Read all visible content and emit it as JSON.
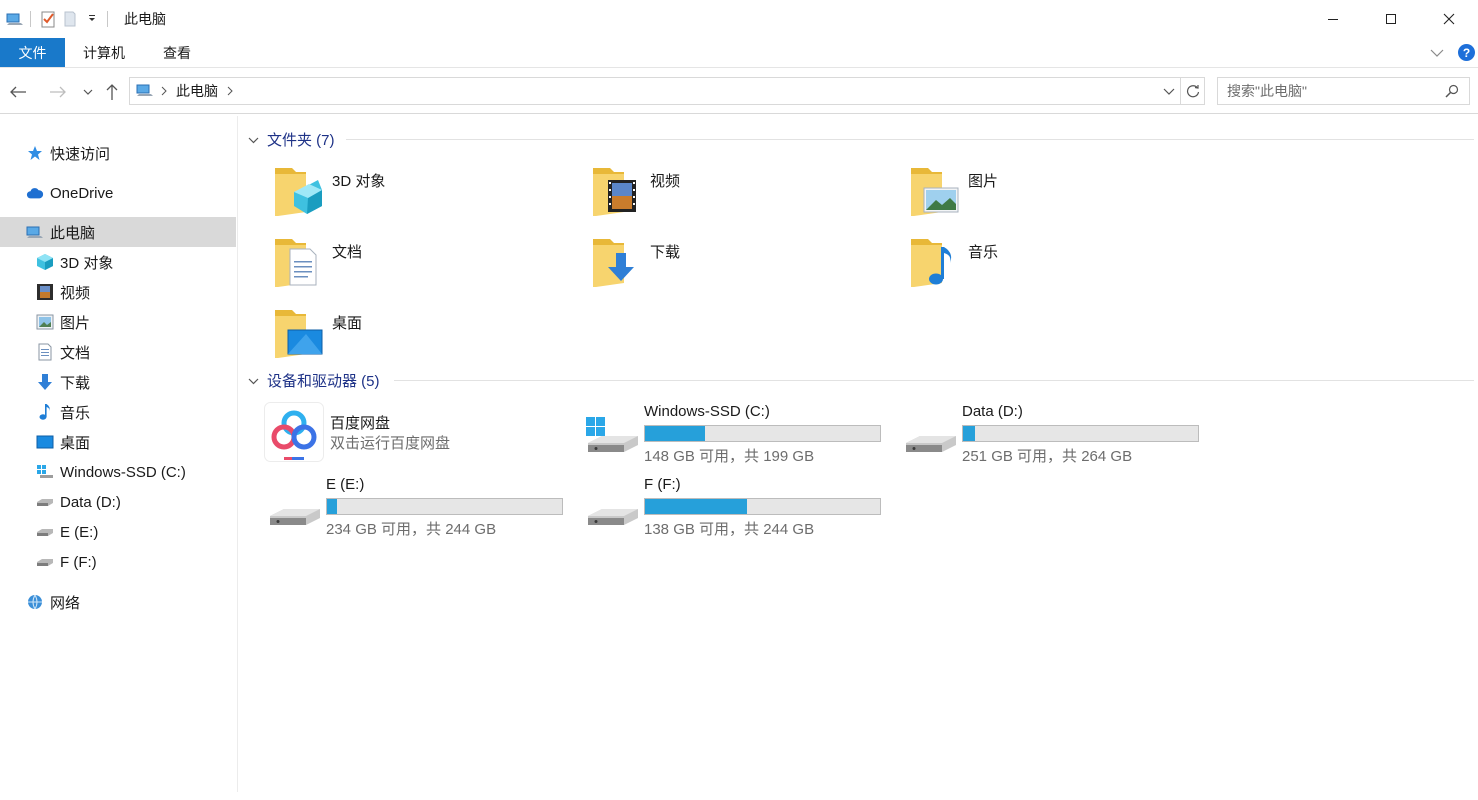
{
  "window": {
    "title": "此电脑"
  },
  "ribbon": {
    "tabs": [
      "文件",
      "计算机",
      "查看"
    ]
  },
  "address": {
    "crumbs": [
      "此电脑"
    ]
  },
  "search": {
    "placeholder": "搜索\"此电脑\""
  },
  "sidebar": {
    "items": [
      {
        "label": "快速访问",
        "icon": "star-icon"
      },
      {
        "label": "OneDrive",
        "icon": "cloud-icon"
      },
      {
        "label": "此电脑",
        "icon": "computer-icon",
        "selected": true
      },
      {
        "label": "3D 对象",
        "icon": "cube-icon"
      },
      {
        "label": "视频",
        "icon": "film-icon"
      },
      {
        "label": "图片",
        "icon": "picture-icon"
      },
      {
        "label": "文档",
        "icon": "document-icon"
      },
      {
        "label": "下载",
        "icon": "download-icon"
      },
      {
        "label": "音乐",
        "icon": "music-icon"
      },
      {
        "label": "桌面",
        "icon": "desktop-icon"
      },
      {
        "label": "Windows-SSD (C:)",
        "icon": "windows-drive-icon"
      },
      {
        "label": "Data (D:)",
        "icon": "drive-icon"
      },
      {
        "label": "E (E:)",
        "icon": "drive-icon"
      },
      {
        "label": "F (F:)",
        "icon": "drive-icon"
      },
      {
        "label": "网络",
        "icon": "network-icon"
      }
    ]
  },
  "folders": {
    "header": "文件夹 (7)",
    "items": [
      {
        "label": "3D 对象",
        "icon": "cube-folder-icon"
      },
      {
        "label": "视频",
        "icon": "video-folder-icon"
      },
      {
        "label": "图片",
        "icon": "pictures-folder-icon"
      },
      {
        "label": "文档",
        "icon": "documents-folder-icon"
      },
      {
        "label": "下载",
        "icon": "downloads-folder-icon"
      },
      {
        "label": "音乐",
        "icon": "music-folder-icon"
      },
      {
        "label": "桌面",
        "icon": "desktop-folder-icon"
      }
    ]
  },
  "devices": {
    "header": "设备和驱动器 (5)",
    "baidu": {
      "label": "百度网盘",
      "sub": "双击运行百度网盘"
    },
    "drives": [
      {
        "label": "Windows-SSD (C:)",
        "sub": "148 GB 可用，共 199 GB",
        "used_fraction": 0.256
      },
      {
        "label": "Data (D:)",
        "sub": "251 GB 可用，共 264 GB",
        "used_fraction": 0.049
      },
      {
        "label": "E (E:)",
        "sub": "234 GB 可用，共 244 GB",
        "used_fraction": 0.041
      },
      {
        "label": "F (F:)",
        "sub": "138 GB 可用，共 244 GB",
        "used_fraction": 0.434
      }
    ]
  },
  "colors": {
    "accent": "#1979ca",
    "drive_bar": "#26a0da",
    "group_header": "#1e3287"
  }
}
